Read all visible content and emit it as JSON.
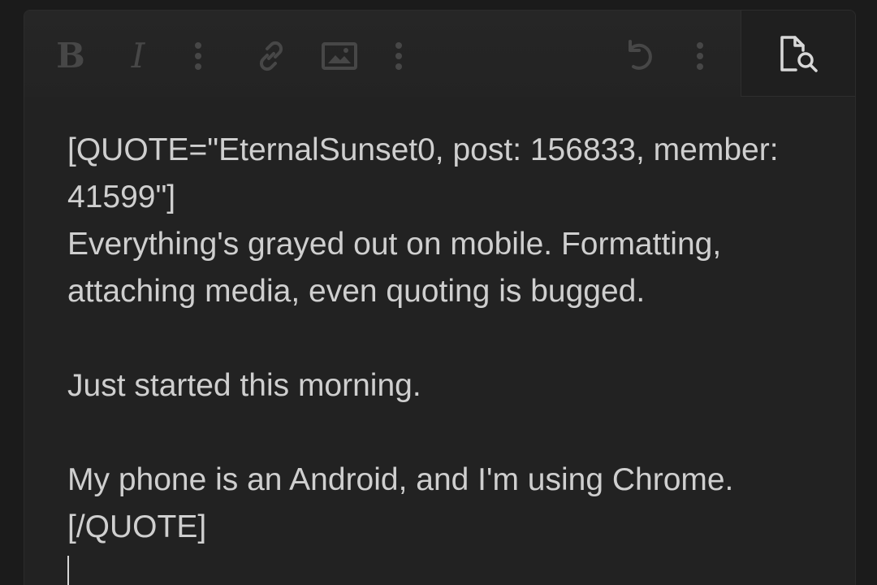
{
  "toolbar": {
    "bold_label": "B",
    "italic_label": "I",
    "buttons": [
      "bold-icon",
      "italic-icon",
      "more-vertical-icon",
      "link-icon",
      "image-icon",
      "more-vertical-icon",
      "undo-icon",
      "more-vertical-icon"
    ],
    "preview_icon": "document-search-icon"
  },
  "editor": {
    "lines": [
      "[QUOTE=\"EternalSunset0, post: 156833, member:",
      "41599\"]",
      "Everything's grayed out on mobile. Formatting,",
      "attaching media, even quoting is bugged.",
      "",
      "Just started this morning.",
      "",
      "My phone is an Android, and I'm using Chrome.",
      "[/QUOTE]"
    ]
  },
  "colors": {
    "background": "#1b1b1b",
    "editor_background": "#222222",
    "toolbar_icon_disabled": "#474747",
    "preview_icon": "#d8d8d8",
    "text": "#cfcfcf"
  }
}
